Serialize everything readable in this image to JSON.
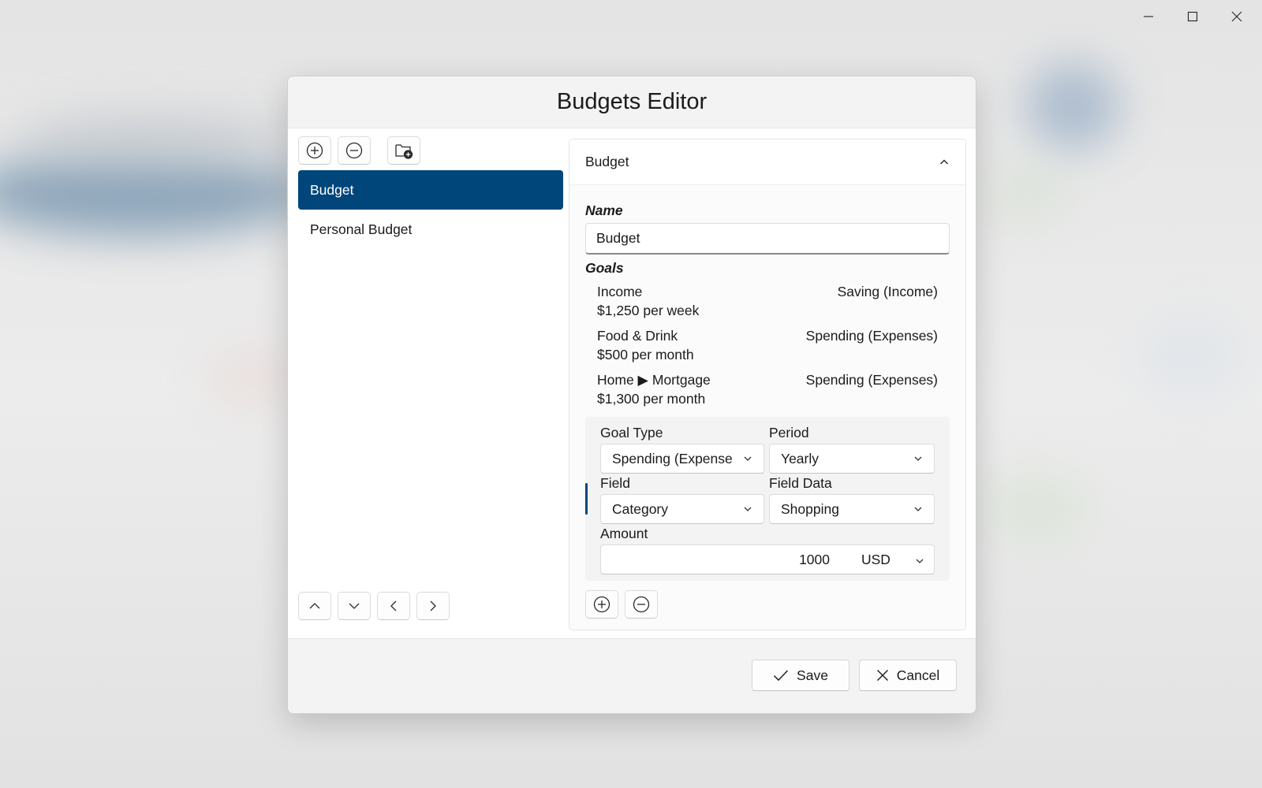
{
  "window": {
    "controls": [
      "minimize-icon",
      "maximize-icon",
      "close-icon"
    ]
  },
  "dialog": {
    "title": "Budgets Editor"
  },
  "list_toolbar": {
    "icons": [
      "add-circle-icon",
      "remove-circle-icon",
      "folder-add-icon"
    ]
  },
  "budgets": {
    "items": [
      {
        "label": "Budget",
        "selected": true
      },
      {
        "label": "Personal Budget",
        "selected": false
      }
    ]
  },
  "reorder_toolbar": {
    "icons": [
      "chevron-up-icon",
      "chevron-down-icon",
      "chevron-left-icon",
      "chevron-right-icon"
    ]
  },
  "panel": {
    "header": "Budget",
    "name_label": "Name",
    "name_value": "Budget",
    "goals_label": "Goals",
    "goals": [
      {
        "name": "Income",
        "amount": "$1,250 per week",
        "type": "Saving (Income)"
      },
      {
        "name": "Food & Drink",
        "amount": "$500 per month",
        "type": "Spending (Expenses)"
      },
      {
        "name": "Home ▶ Mortgage",
        "amount": "$1,300 per month",
        "type": "Spending (Expenses)"
      }
    ],
    "editor": {
      "goal_type_label": "Goal Type",
      "goal_type_value": "Spending (Expense",
      "period_label": "Period",
      "period_value": "Yearly",
      "field_label": "Field",
      "field_value": "Category",
      "field_data_label": "Field Data",
      "field_data_value": "Shopping",
      "amount_label": "Amount",
      "amount_value": "1000",
      "currency": "USD"
    }
  },
  "footer": {
    "save_label": "Save",
    "cancel_label": "Cancel"
  },
  "colors": {
    "accent": "#00467a",
    "dialog_bg": "#f3f3f3",
    "body_bg": "#ffffff"
  }
}
